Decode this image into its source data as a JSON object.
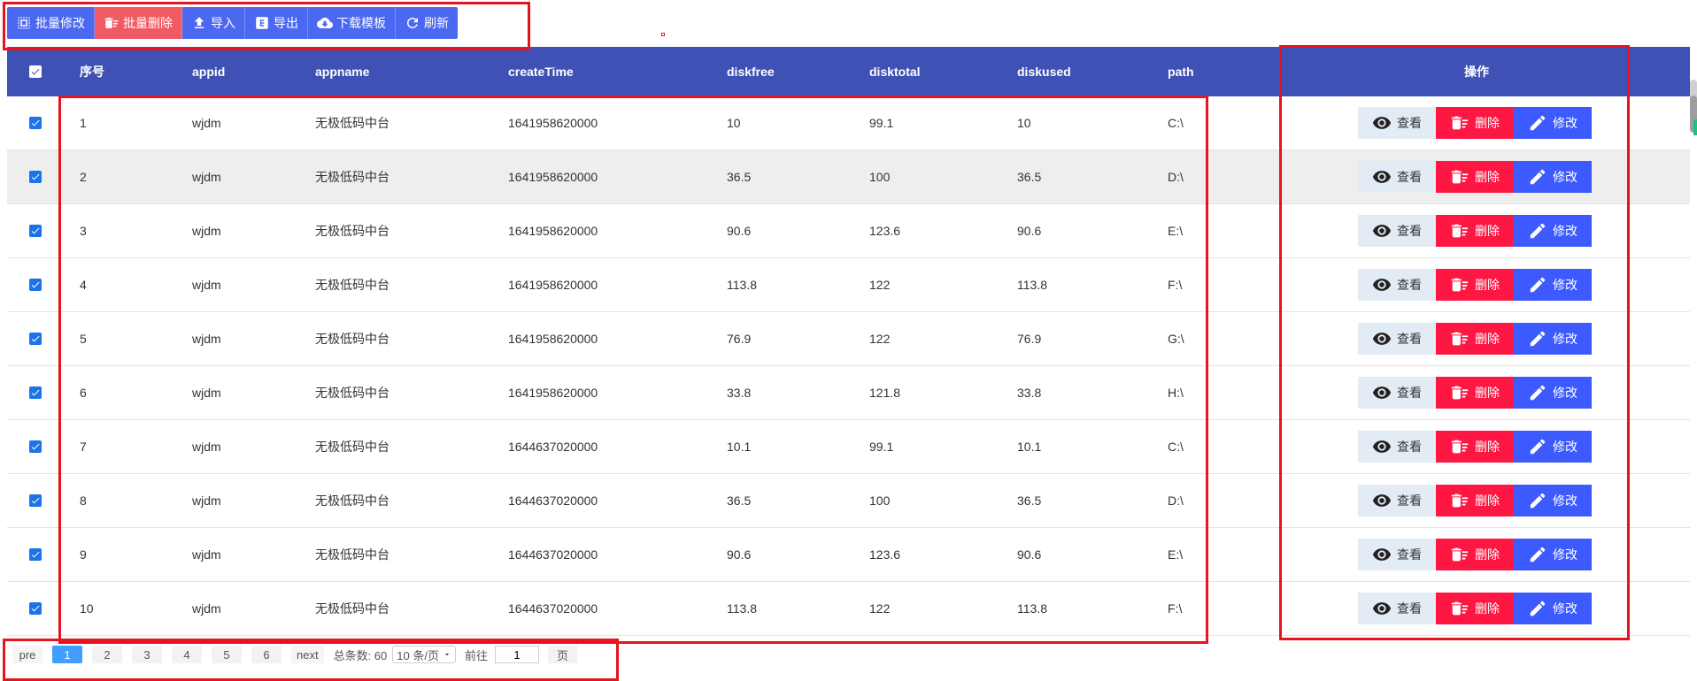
{
  "toolbar": {
    "batch_edit": "批量修改",
    "batch_delete": "批量删除",
    "import": "导入",
    "export": "导出",
    "download_template": "下载模板",
    "refresh": "刷新"
  },
  "table": {
    "headers": {
      "index": "序号",
      "appid": "appid",
      "appname": "appname",
      "createTime": "createTime",
      "diskfree": "diskfree",
      "disktotal": "disktotal",
      "diskused": "diskused",
      "path": "path",
      "actions": "操作"
    },
    "rows": [
      {
        "index": "1",
        "appid": "wjdm",
        "appname": "无极低码中台",
        "createTime": "1641958620000",
        "diskfree": "10",
        "disktotal": "99.1",
        "diskused": "10",
        "path": "C:\\"
      },
      {
        "index": "2",
        "appid": "wjdm",
        "appname": "无极低码中台",
        "createTime": "1641958620000",
        "diskfree": "36.5",
        "disktotal": "100",
        "diskused": "36.5",
        "path": "D:\\"
      },
      {
        "index": "3",
        "appid": "wjdm",
        "appname": "无极低码中台",
        "createTime": "1641958620000",
        "diskfree": "90.6",
        "disktotal": "123.6",
        "diskused": "90.6",
        "path": "E:\\"
      },
      {
        "index": "4",
        "appid": "wjdm",
        "appname": "无极低码中台",
        "createTime": "1641958620000",
        "diskfree": "113.8",
        "disktotal": "122",
        "diskused": "113.8",
        "path": "F:\\"
      },
      {
        "index": "5",
        "appid": "wjdm",
        "appname": "无极低码中台",
        "createTime": "1641958620000",
        "diskfree": "76.9",
        "disktotal": "122",
        "diskused": "76.9",
        "path": "G:\\"
      },
      {
        "index": "6",
        "appid": "wjdm",
        "appname": "无极低码中台",
        "createTime": "1641958620000",
        "diskfree": "33.8",
        "disktotal": "121.8",
        "diskused": "33.8",
        "path": "H:\\"
      },
      {
        "index": "7",
        "appid": "wjdm",
        "appname": "无极低码中台",
        "createTime": "1644637020000",
        "diskfree": "10.1",
        "disktotal": "99.1",
        "diskused": "10.1",
        "path": "C:\\"
      },
      {
        "index": "8",
        "appid": "wjdm",
        "appname": "无极低码中台",
        "createTime": "1644637020000",
        "diskfree": "36.5",
        "disktotal": "100",
        "diskused": "36.5",
        "path": "D:\\"
      },
      {
        "index": "9",
        "appid": "wjdm",
        "appname": "无极低码中台",
        "createTime": "1644637020000",
        "diskfree": "90.6",
        "disktotal": "123.6",
        "diskused": "90.6",
        "path": "E:\\"
      },
      {
        "index": "10",
        "appid": "wjdm",
        "appname": "无极低码中台",
        "createTime": "1644637020000",
        "diskfree": "113.8",
        "disktotal": "122",
        "diskused": "113.8",
        "path": "F:\\"
      }
    ],
    "actions": {
      "view": "查看",
      "delete": "删除",
      "edit": "修改"
    }
  },
  "pager": {
    "prev": "pre",
    "pages": [
      "1",
      "2",
      "3",
      "4",
      "5",
      "6"
    ],
    "active_page": "1",
    "next": "next",
    "total_label": "总条数: 60",
    "page_size": "10 条/页",
    "goto_label": "前往",
    "goto_value": "1",
    "goto_unit": "页"
  },
  "colors": {
    "header_bg": "#3f51b5",
    "toolbar_primary": "#4b68f0",
    "toolbar_danger": "#f05b63",
    "delete_btn": "#ff1744",
    "edit_btn": "#3d5afe",
    "view_btn": "#e3ecf5",
    "pager_active": "#409eff",
    "highlight": "#e6141e"
  }
}
